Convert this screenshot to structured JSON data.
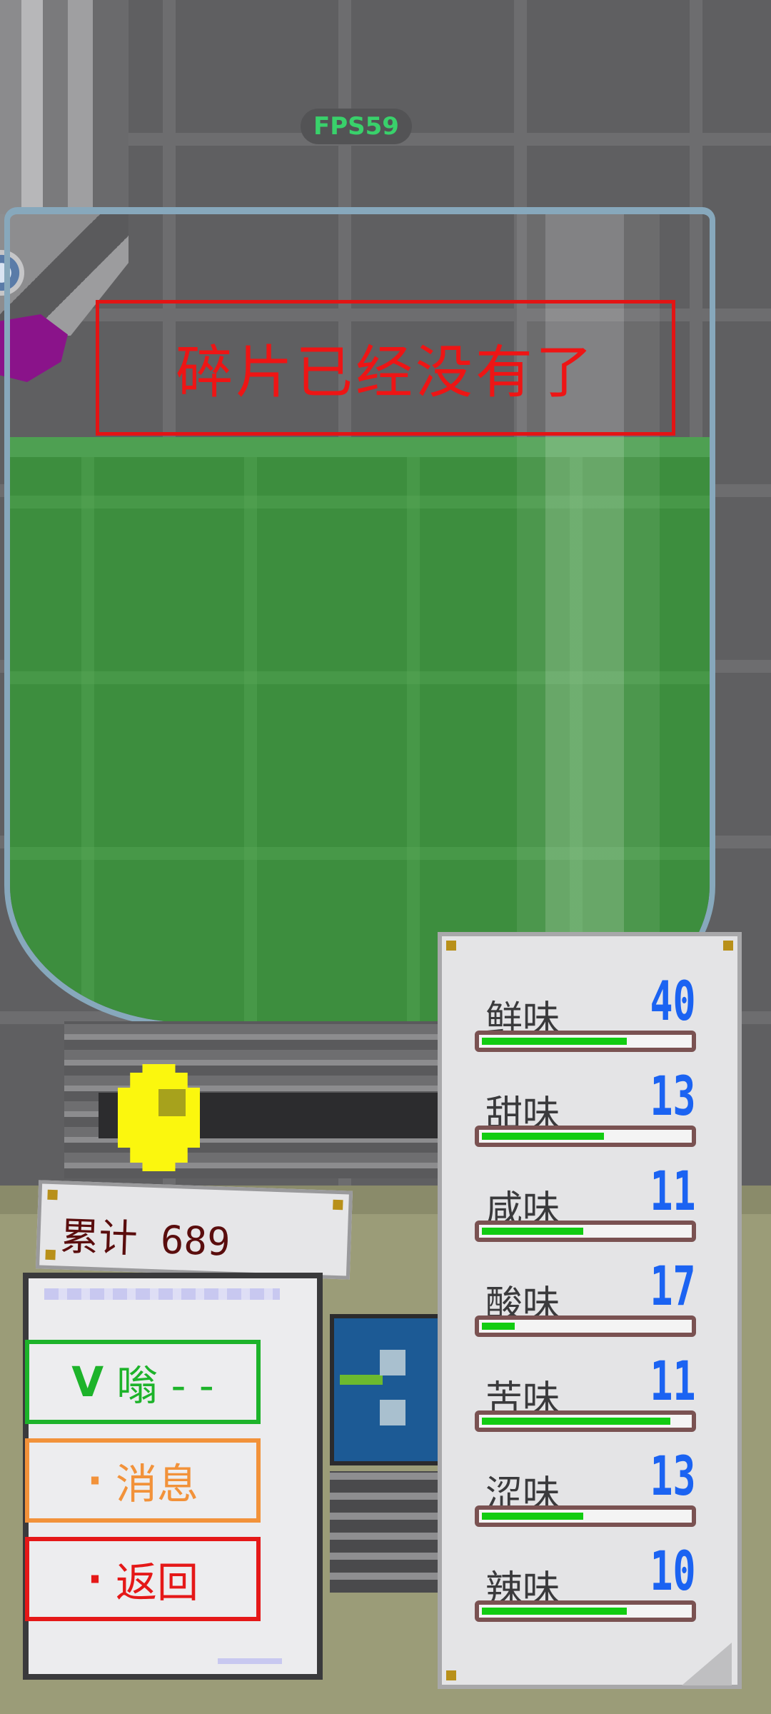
{
  "hud": {
    "fps": "FPS59"
  },
  "notice": {
    "text": "碎片已经没有了"
  },
  "counter": {
    "text": "累计 689"
  },
  "menu": {
    "items": [
      {
        "icon": "V",
        "label": "嗡 - -"
      },
      {
        "icon": "·",
        "label": "消息"
      },
      {
        "icon": "·",
        "label": "返回"
      }
    ]
  },
  "flavors": [
    {
      "name": "鲜味",
      "value": "40",
      "level": 0.7
    },
    {
      "name": "甜味",
      "value": "13",
      "level": 0.59
    },
    {
      "name": "咸味",
      "value": "11",
      "level": 0.49
    },
    {
      "name": "酸味",
      "value": "17",
      "level": 0.16
    },
    {
      "name": "苦味",
      "value": "11",
      "level": 0.91
    },
    {
      "name": "涩味",
      "value": "13",
      "level": 0.49
    },
    {
      "name": "辣味",
      "value": "10",
      "level": 0.7
    }
  ],
  "colors": {
    "liquid": "#3d8e3e",
    "notice": "#e31414",
    "bar_fill": "#12cc12",
    "flavor_value": "#1b63f2"
  }
}
